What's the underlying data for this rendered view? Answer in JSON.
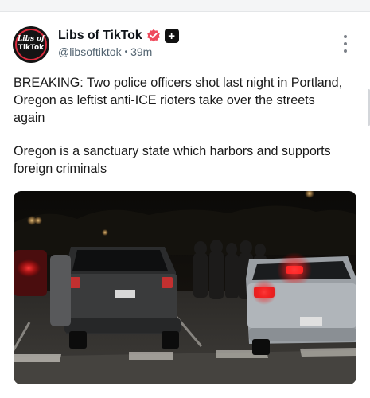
{
  "post": {
    "author": {
      "display_name": "Libs of TikTok",
      "handle": "@libsoftiktok",
      "avatar_text_line1": "Libs of",
      "avatar_text_line2": "TikTok"
    },
    "time_separator": "•",
    "timestamp": "39m",
    "plus_badge": "+",
    "body_paragraphs": [
      "BREAKING: Two police officers shot last night in Portland, Oregon as leftist anti-ICE rioters take over the streets again",
      "Oregon is a sanctuary state which harbors and supports foreign criminals"
    ],
    "media": {
      "icon": "photo-night-street-police-cars"
    }
  },
  "colors": {
    "verified_badge": "#ef4a5c",
    "text": "#1a1a1a",
    "secondary_text": "#536471",
    "police_light_red": "#ff2a2a"
  },
  "icons": {
    "verified": "verified-badge-icon",
    "plus": "plus-icon",
    "more": "more-options-icon"
  }
}
